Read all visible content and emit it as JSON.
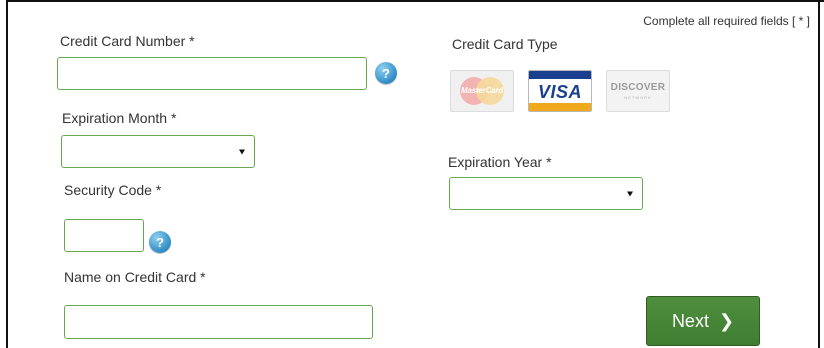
{
  "required_note": "Complete all required fields [ * ]",
  "fields": {
    "card_number": {
      "label": "Credit Card Number *",
      "value": "",
      "help": "?"
    },
    "card_type": {
      "label": "Credit Card Type",
      "options": [
        "MasterCard",
        "VISA",
        "DISCOVER"
      ],
      "discover_sub": "NETWORK"
    },
    "exp_month": {
      "label": "Expiration Month *",
      "selected": ""
    },
    "exp_year": {
      "label": "Expiration Year *",
      "selected": ""
    },
    "security_code": {
      "label": "Security Code *",
      "value": "",
      "help": "?"
    },
    "name_on_card": {
      "label": "Name on Credit Card *",
      "value": ""
    }
  },
  "next_button": {
    "label": "Next",
    "icon": "chevron-right-icon"
  },
  "colors": {
    "field_border": "#6aa84f",
    "button_bg": "#3f7d31",
    "help_icon": "#2f8cc6"
  }
}
